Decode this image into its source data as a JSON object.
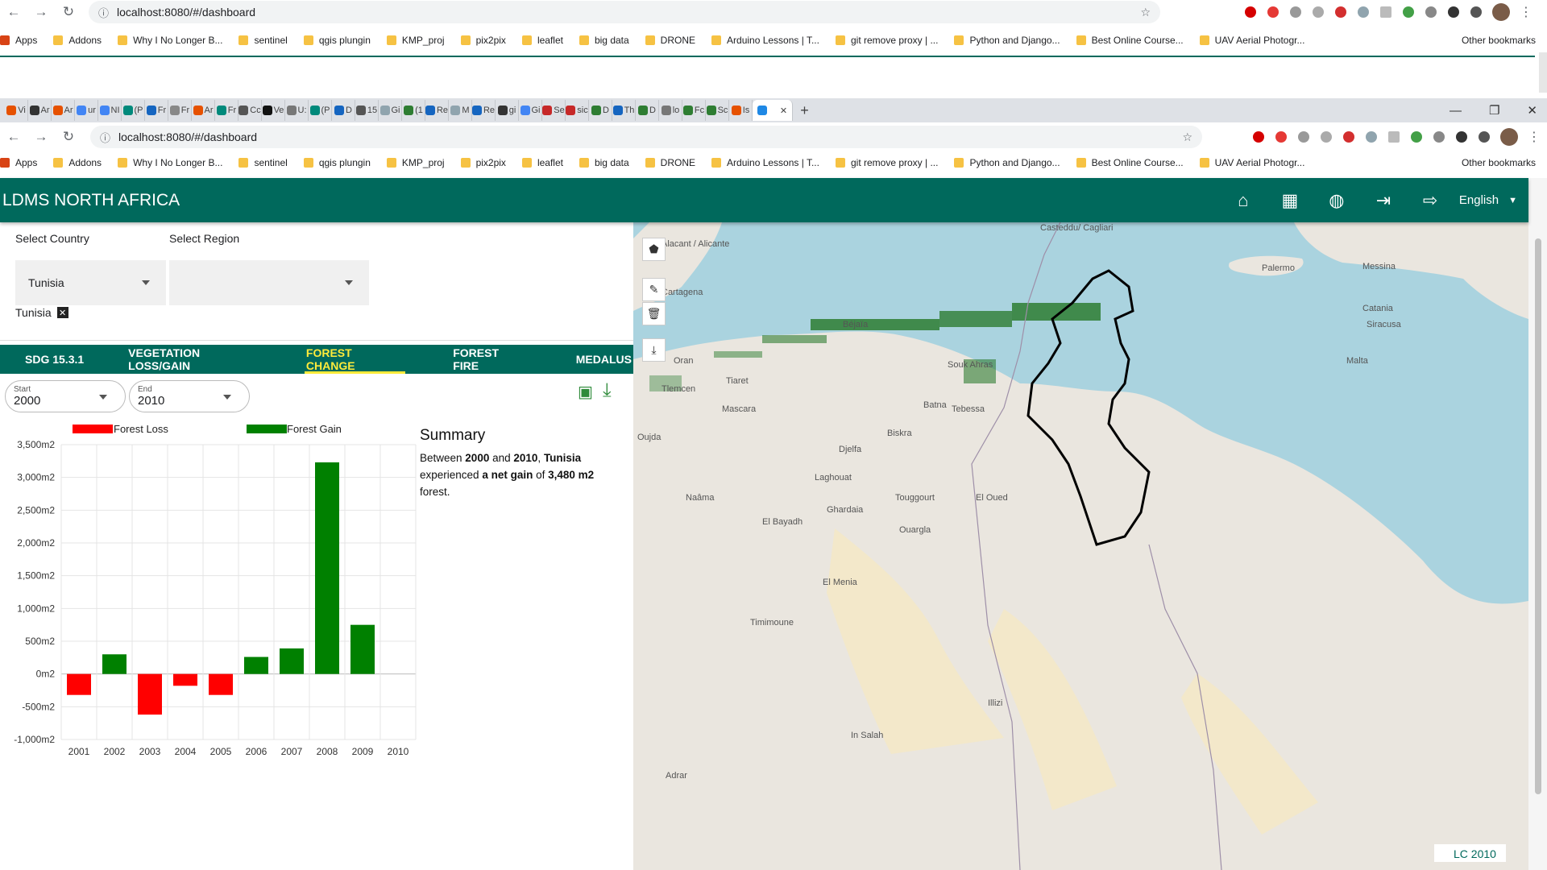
{
  "outer_browser": {
    "url": "localhost:8080/#/dashboard",
    "bookmarks": [
      "Apps",
      "Addons",
      "Why I No Longer B...",
      "sentinel",
      "qgis plungin",
      "KMP_proj",
      "pix2pix",
      "leaflet",
      "big data",
      "DRONE",
      "Arduino Lessons | T...",
      "git remove proxy | ...",
      "Python and Django...",
      "Best Online Course...",
      "UAV Aerial Photogr..."
    ],
    "other_bookmarks": "Other bookmarks"
  },
  "inner_browser": {
    "tab_labels": [
      "Vi",
      "Ar",
      "Ar",
      "ur",
      "NI",
      "(P",
      "Fr",
      "Fr",
      "Ar",
      "Fr",
      "Cc",
      "Ve",
      "U:",
      "(P",
      "D",
      "15",
      "Gi",
      "(1",
      "Re",
      "M",
      "Re",
      "gi",
      "Gi",
      "Se",
      "sic",
      "D",
      "Th",
      "D",
      "lo",
      "Fc",
      "Sc",
      "Is"
    ],
    "url": "localhost:8080/#/dashboard",
    "bookmarks": [
      "Apps",
      "Addons",
      "Why I No Longer B...",
      "sentinel",
      "qgis plungin",
      "KMP_proj",
      "pix2pix",
      "leaflet",
      "big data",
      "DRONE",
      "Arduino Lessons | T...",
      "git remove proxy | ...",
      "Python and Django...",
      "Best Online Course...",
      "UAV Aerial Photogr..."
    ],
    "other_bookmarks": "Other bookmarks"
  },
  "app": {
    "title": "LDMS NORTH AFRICA",
    "language": "English",
    "icons": [
      "home-icon",
      "dashboard-icon",
      "globe-icon",
      "login-icon",
      "logout-icon"
    ]
  },
  "filters": {
    "country_label": "Select Country",
    "region_label": "Select Region",
    "country_value": "Tunisia",
    "region_value": "",
    "chip": "Tunisia",
    "chip_close": "✕"
  },
  "tabs": [
    "SDG 15.3.1",
    "VEGETATION LOSS/GAIN",
    "FOREST CHANGE",
    "FOREST FIRE",
    "MEDALUS"
  ],
  "active_tab": "FOREST CHANGE",
  "period": {
    "start_label": "Start",
    "start_value": "2000",
    "end_label": "End",
    "end_value": "2010"
  },
  "summary": {
    "heading": "Summary",
    "t1": "Between ",
    "start": "2000",
    "t2": " and ",
    "end": "2010",
    "t3": ", ",
    "country": "Tunisia",
    "t4": " experienced ",
    "gain_phrase": "a net gain",
    "t5": " of ",
    "amount": "3,480 m2",
    "t6": " forest."
  },
  "chart_data": {
    "type": "bar",
    "categories": [
      "2001",
      "2002",
      "2003",
      "2004",
      "2005",
      "2006",
      "2007",
      "2008",
      "2009",
      "2010"
    ],
    "values": [
      -320,
      300,
      -620,
      -180,
      -320,
      260,
      390,
      3230,
      750,
      0
    ],
    "legend": [
      "Forest Loss",
      "Forest Gain"
    ],
    "colors": {
      "loss": "#ff0000",
      "gain": "#008000"
    },
    "y_ticks": [
      "3,500m2",
      "3,000m2",
      "2,500m2",
      "2,000m2",
      "1,500m2",
      "1,000m2",
      "500m2",
      "0m2",
      "-500m2",
      "-1,000m2"
    ],
    "ylim": [
      -1000,
      3500
    ],
    "grid": true,
    "legend_position": "top"
  },
  "map": {
    "badge": "LC 2010",
    "places": [
      "Alacant / Alicante",
      "Cartagena",
      "Casteddu/ Cagliari",
      "Palermo",
      "Messina",
      "Catania",
      "Siracusa",
      "Malta",
      "Oran",
      "Tiaret",
      "Mascara",
      "Tlemcen",
      "Oujda",
      "Biskra",
      "Djelfa",
      "Laghouat",
      "Touggourt",
      "Ouargla",
      "Ghardaia",
      "El Bayadh",
      "El Menia",
      "Timimoune",
      "Naâma",
      "El Oued",
      "Tebessa",
      "Souk Ahras",
      "Batna",
      "Béjaïa",
      "Illizi",
      "In Salah",
      "Adrar"
    ],
    "controls": [
      "draw-polygon-icon",
      "edit-icon",
      "delete-icon",
      "download-icon"
    ]
  },
  "theme": {
    "primary": "#00695c",
    "accent": "#ffeb3b"
  }
}
